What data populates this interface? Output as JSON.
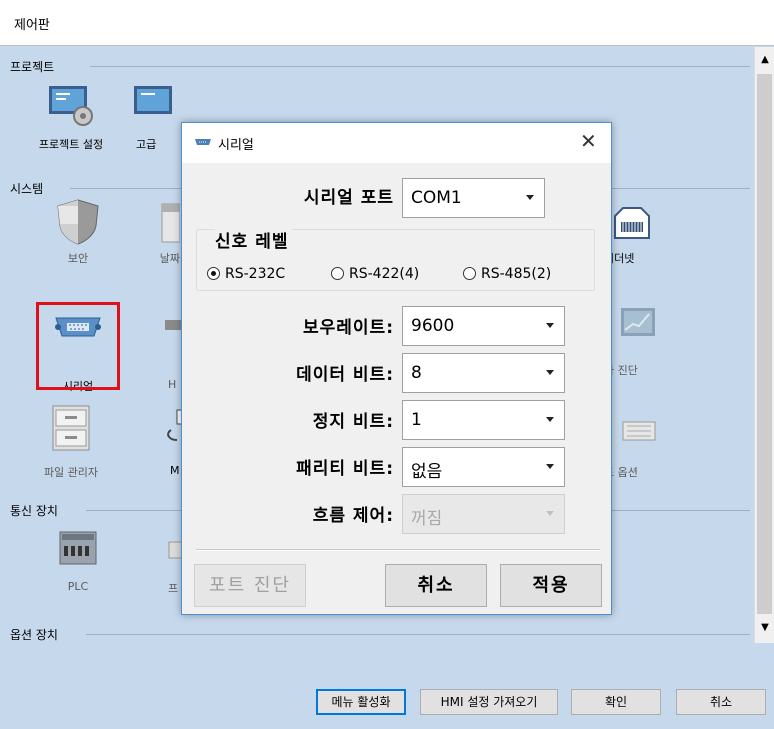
{
  "window": {
    "title": "제어판"
  },
  "sections": {
    "project": "프로젝트",
    "system": "시스템",
    "comm": "통신 장치",
    "option": "옵션 장치"
  },
  "items": {
    "project_settings": "프로젝트 설정",
    "advanced": "고급",
    "security": "보안",
    "date": "날짜",
    "ethernet": "이더넷",
    "serial": "시리얼",
    "h_item": "H",
    "diag": "가 진단",
    "file_manager": "파일 관리자",
    "m_item": "M",
    "keyboard_option": "드 옵션",
    "plc": "PLC",
    "printer": "프"
  },
  "bottom_buttons": {
    "menu_activate": "메뉴 활성화",
    "import_hmi": "HMI 설정 가져오기",
    "ok": "확인",
    "cancel": "취소"
  },
  "dialog": {
    "title": "시리얼",
    "close": "✕",
    "serial_port_label": "시리얼 포트",
    "serial_port_value": "COM1",
    "signal_level_label": "신호 레벨",
    "radios": [
      "RS-232C",
      "RS-422(4)",
      "RS-485(2)"
    ],
    "baud_label": "보우레이트:",
    "baud_value": "9600",
    "data_bits_label": "데이터 비트:",
    "data_bits_value": "8",
    "stop_bits_label": "정지 비트:",
    "stop_bits_value": "1",
    "parity_label": "패리티 비트:",
    "parity_value": "없음",
    "flow_label": "흐름 제어:",
    "flow_value": "꺼짐",
    "port_diag": "포트 진단",
    "cancel": "취소",
    "apply": "적용"
  }
}
